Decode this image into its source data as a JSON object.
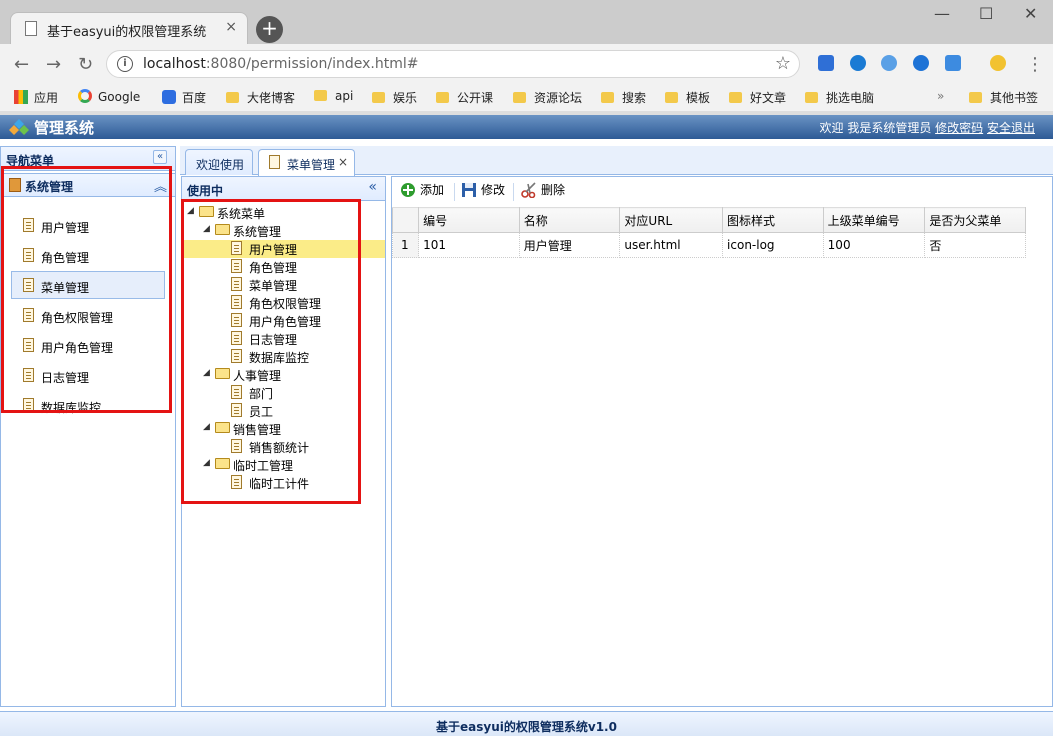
{
  "browser": {
    "tab_title": "基于easyui的权限管理系统",
    "tab_close": "×",
    "new_tab": "+",
    "url_host": "localhost",
    "url_rest": ":8080/permission/index.html#",
    "bookmarks": [
      "应用",
      "Google",
      "百度",
      "大佬博客",
      "api",
      "娱乐",
      "公开课",
      "资源论坛",
      "搜索",
      "模板",
      "好文章",
      "挑选电脑"
    ],
    "more": "»",
    "other_bookmarks": "其他书签"
  },
  "header": {
    "title": "管理系统",
    "welcome": "欢迎 我是系统管理员 ",
    "change_password": "修改密码",
    "logout": "安全退出"
  },
  "nav": {
    "title": "导航菜单",
    "collapse": "«",
    "section": "系统管理",
    "section_arrow": "︽",
    "items": [
      "用户管理",
      "角色管理",
      "菜单管理",
      "角色权限管理",
      "用户角色管理",
      "日志管理",
      "数据库监控"
    ],
    "selected": "菜单管理"
  },
  "tabs": [
    {
      "label": "欢迎使用"
    },
    {
      "label": "菜单管理",
      "close": "×"
    }
  ],
  "tree": {
    "title": "使用中",
    "collapse": "«",
    "nodes": [
      "系统菜单",
      "系统管理",
      "用户管理",
      "角色管理",
      "菜单管理",
      "角色权限管理",
      "用户角色管理",
      "日志管理",
      "数据库监控",
      "人事管理",
      "部门",
      "员工",
      "销售管理",
      "销售额统计",
      "临时工管理",
      "临时工计件"
    ]
  },
  "grid": {
    "toolbar": {
      "add": "添加",
      "edit": "修改",
      "delete": "删除"
    },
    "columns": [
      "编号",
      "名称",
      "对应URL",
      "图标样式",
      "上级菜单编号",
      "是否为父菜单"
    ],
    "rows": [
      {
        "rownum": "1",
        "cells": [
          "101",
          "用户管理",
          "user.html",
          "icon-log",
          "100",
          "否"
        ]
      }
    ]
  },
  "footer": "基于easyui的权限管理系统v1.0",
  "colors": {
    "highlight": "#e41313",
    "header": "#2d5a95",
    "selected_row": "#fbec88"
  }
}
